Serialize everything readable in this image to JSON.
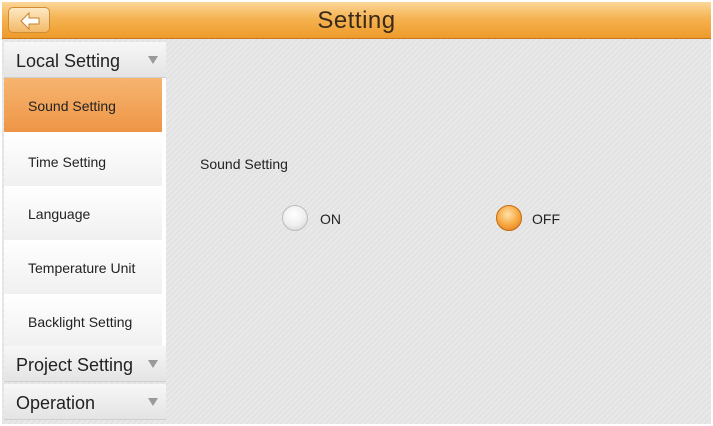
{
  "header": {
    "title": "Setting",
    "back_icon": "back-arrow-icon"
  },
  "sidebar": {
    "sections": [
      {
        "label": "Local Setting",
        "expanded": true
      },
      {
        "label": "Project Setting",
        "expanded": false
      },
      {
        "label": "Operation",
        "expanded": false
      }
    ],
    "items": [
      {
        "label": "Sound Setting",
        "selected": true
      },
      {
        "label": "Time Setting",
        "selected": false
      },
      {
        "label": "Language",
        "selected": false
      },
      {
        "label": "Temperature Unit",
        "selected": false
      },
      {
        "label": "Backlight Setting",
        "selected": false
      }
    ]
  },
  "main": {
    "title": "Sound Setting",
    "options": [
      {
        "label": "ON",
        "selected": false
      },
      {
        "label": "OFF",
        "selected": true
      }
    ]
  },
  "colors": {
    "accent": "#f0a04b",
    "titlebar": "#f5b352"
  }
}
